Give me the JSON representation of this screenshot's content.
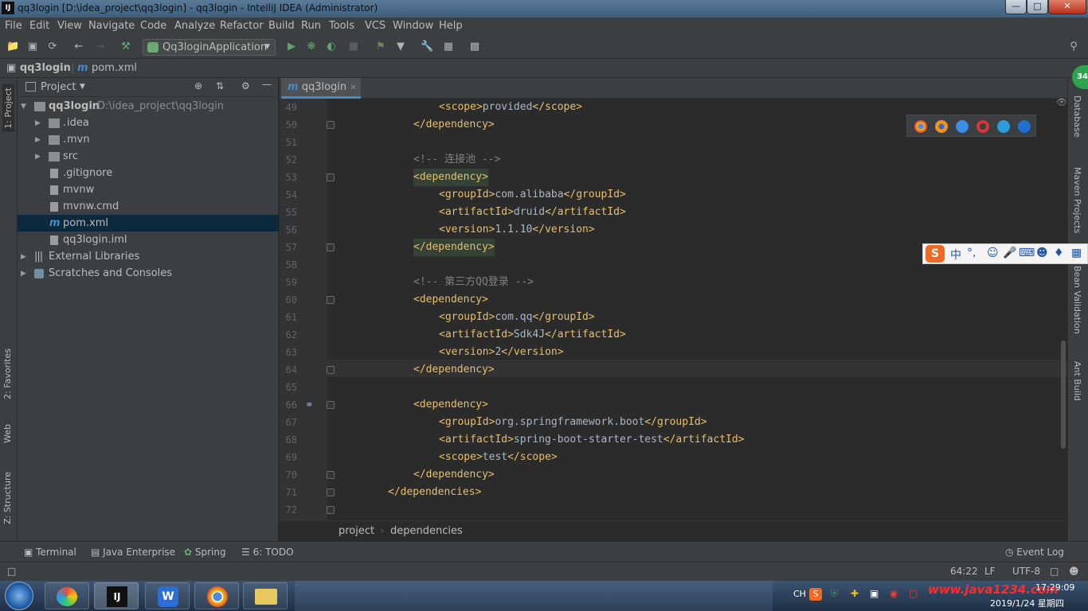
{
  "window": {
    "app_icon": "IJ",
    "title": "qq3login [D:\\idea_project\\qq3login] - qq3login - IntelliJ IDEA (Administrator)",
    "controls": [
      "minimize-icon",
      "maximize-icon",
      "close-icon"
    ]
  },
  "menu": [
    "File",
    "Edit",
    "View",
    "Navigate",
    "Code",
    "Analyze",
    "Refactor",
    "Build",
    "Run",
    "Tools",
    "VCS",
    "Window",
    "Help"
  ],
  "toolbar": {
    "run_config": "Qq3loginApplication"
  },
  "navbar": {
    "project": "qq3login",
    "file": "pom.xml"
  },
  "left_tool_tabs": [
    "1: Project",
    "2: Favorites",
    "Web",
    "Z: Structure"
  ],
  "right_tool_tabs": [
    "Database",
    "Maven Projects",
    "Bean Validation",
    "Ant Build"
  ],
  "project_panel": {
    "title": "Project",
    "root_name": "qq3login",
    "root_path": "D:\\idea_project\\qq3login",
    "items": [
      {
        "label": "idea",
        "prefix": "."
      },
      {
        "label": "mvn",
        "prefix": "."
      },
      {
        "label": "src",
        "prefix": ""
      },
      {
        "label": ".gitignore",
        "prefix": ""
      },
      {
        "label": "mvnw",
        "prefix": ""
      },
      {
        "label": "mvnw.cmd",
        "prefix": ""
      },
      {
        "label": "pom.xml",
        "prefix": ""
      },
      {
        "label": "qq3login.iml",
        "prefix": ""
      },
      {
        "label": "External Libraries",
        "prefix": ""
      },
      {
        "label": "Scratches and Consoles",
        "prefix": ""
      }
    ]
  },
  "editor": {
    "tab": "qq3login",
    "lines": [
      {
        "n": "49",
        "indent": 3,
        "text": "<scope>provided</scope>"
      },
      {
        "n": "50",
        "indent": 2,
        "text": "</dependency>"
      },
      {
        "n": "51",
        "indent": 0,
        "text": ""
      },
      {
        "n": "52",
        "indent": 2,
        "text": "<!-- 连接池 -->"
      },
      {
        "n": "53",
        "indent": 2,
        "text": "<dependency>"
      },
      {
        "n": "54",
        "indent": 3,
        "text": "<groupId>com.alibaba</groupId>"
      },
      {
        "n": "55",
        "indent": 3,
        "text": "<artifactId>druid</artifactId>"
      },
      {
        "n": "56",
        "indent": 3,
        "text": "<version>1.1.10</version>"
      },
      {
        "n": "57",
        "indent": 2,
        "text": "</dependency>"
      },
      {
        "n": "58",
        "indent": 0,
        "text": ""
      },
      {
        "n": "59",
        "indent": 2,
        "text": "<!-- 第三方QQ登录 -->"
      },
      {
        "n": "60",
        "indent": 2,
        "text": "<dependency>"
      },
      {
        "n": "61",
        "indent": 3,
        "text": "<groupId>com.qq</groupId>"
      },
      {
        "n": "62",
        "indent": 3,
        "text": "<artifactId>Sdk4J</artifactId>"
      },
      {
        "n": "63",
        "indent": 3,
        "text": "<version>2</version>"
      },
      {
        "n": "64",
        "indent": 2,
        "text": "</dependency>"
      },
      {
        "n": "65",
        "indent": 0,
        "text": ""
      },
      {
        "n": "66",
        "indent": 2,
        "text": "<dependency>"
      },
      {
        "n": "67",
        "indent": 3,
        "text": "<groupId>org.springframework.boot</groupId>"
      },
      {
        "n": "68",
        "indent": 3,
        "text": "<artifactId>spring-boot-starter-test</artifactId>"
      },
      {
        "n": "69",
        "indent": 3,
        "text": "<scope>test</scope>"
      },
      {
        "n": "70",
        "indent": 2,
        "text": "</dependency>"
      },
      {
        "n": "71",
        "indent": 1,
        "text": "</dependencies>"
      },
      {
        "n": "72",
        "indent": 0,
        "text": ""
      }
    ],
    "breadcrumbs": [
      "project",
      "dependencies"
    ]
  },
  "bottom_tools": [
    "Terminal",
    "Java Enterprise",
    "Spring",
    "6: TODO",
    "Event Log"
  ],
  "status": {
    "position": "64:22",
    "line_sep": "LF",
    "encoding": "UTF-8"
  },
  "ime": {
    "lang": "中",
    "punct": "°,"
  },
  "badge": "34",
  "taskbar": {
    "tray_lang": "CH",
    "watermark": "www.java1234.com",
    "clock_time": "17:29:09",
    "clock_date": "2019/1/24 星期四"
  },
  "colors": {
    "accent": "#4a88c7",
    "tag": "#e8bf6a",
    "comment": "#808080",
    "watermark": "#ff2a2a"
  }
}
